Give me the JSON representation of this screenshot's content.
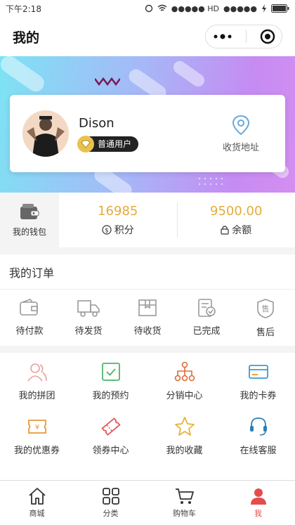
{
  "status_bar": {
    "time": "下午2:18",
    "signal": "●●●●● HD",
    "signal2": "●●●●●"
  },
  "nav": {
    "title": "我的"
  },
  "profile": {
    "name": "Dison",
    "level": "普通用户",
    "address_label": "收货地址"
  },
  "wallet": {
    "label": "我的钱包"
  },
  "stats": [
    {
      "value": "16985",
      "label": "积分"
    },
    {
      "value": "9500.00",
      "label": "余额"
    }
  ],
  "orders": {
    "title": "我的订单",
    "items": [
      {
        "label": "待付款",
        "icon": "wallet-icon"
      },
      {
        "label": "待发货",
        "icon": "truck-icon"
      },
      {
        "label": "待收货",
        "icon": "package-icon"
      },
      {
        "label": "已完成",
        "icon": "done-document-icon"
      },
      {
        "label": "售后",
        "icon": "after-sale-icon"
      }
    ]
  },
  "services": [
    {
      "label": "我的拼团",
      "icon": "group-icon"
    },
    {
      "label": "我的预约",
      "icon": "calendar-check-icon"
    },
    {
      "label": "分销中心",
      "icon": "network-icon"
    },
    {
      "label": "我的卡券",
      "icon": "card-icon"
    },
    {
      "label": "我的优惠券",
      "icon": "coupon-yen-icon"
    },
    {
      "label": "领券中心",
      "icon": "ticket-icon"
    },
    {
      "label": "我的收藏",
      "icon": "star-icon"
    },
    {
      "label": "在线客服",
      "icon": "headset-icon"
    }
  ],
  "tabs": [
    {
      "label": "商城",
      "icon": "home-icon"
    },
    {
      "label": "分类",
      "icon": "category-icon"
    },
    {
      "label": "购物车",
      "icon": "cart-icon"
    },
    {
      "label": "我",
      "icon": "person-icon",
      "active": true
    }
  ],
  "colors": {
    "accent": "#e54c4c",
    "gold": "#e3ac3b",
    "hero_start": "#7de3f4",
    "hero_end": "#d48ef0"
  }
}
